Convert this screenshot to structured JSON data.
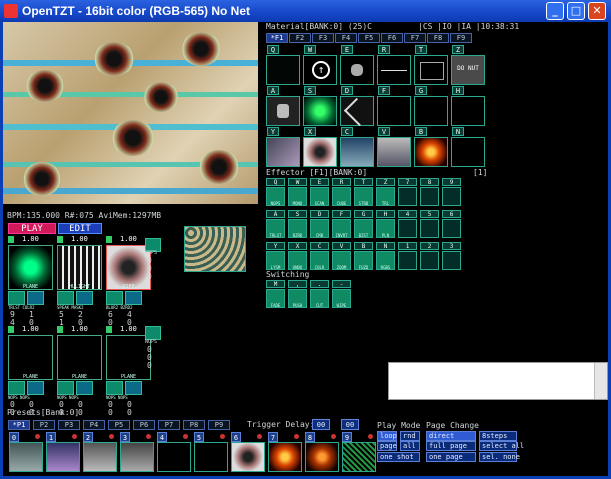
{
  "window": {
    "title": "OpenTZT - 16bit color (RGB-565) No Net",
    "min": "_",
    "max": "□",
    "close": "✕"
  },
  "material": {
    "header": "Material[BANK:0]  (25)C",
    "stats": "|CS |IO  |IA  |10:38:31",
    "tabs": [
      "*F1",
      "F2",
      "F3",
      "F4",
      "F5",
      "F6",
      "F7",
      "F8",
      "F9"
    ],
    "rows": [
      [
        "Q",
        "W",
        "E",
        "R",
        "T",
        "Z"
      ],
      [
        "A",
        "S",
        "D",
        "F",
        "G",
        "H"
      ],
      [
        "Y",
        "X",
        "C",
        "V",
        "B",
        "N"
      ]
    ],
    "donut_text": "DO NUT"
  },
  "effector": {
    "header": "Effector [F1][BANK:0]",
    "header_right": "[1]",
    "rows": [
      [
        "Q",
        "W",
        "E",
        "R",
        "T",
        "Z",
        "7",
        "8",
        "9"
      ],
      [
        "A",
        "S",
        "D",
        "F",
        "G",
        "H",
        "4",
        "5",
        "6"
      ],
      [
        "Y",
        "X",
        "C",
        "V",
        "B",
        "N",
        "1",
        "2",
        "3"
      ]
    ],
    "names": [
      [
        "NOPS",
        "MONO",
        "SCAN",
        "CUBE",
        "STRB",
        "TRL"
      ],
      [
        "TRLST",
        "BZRD",
        "CMB",
        "INVRT",
        "BZST",
        "PLN"
      ],
      [
        "LYSM",
        "UNDO",
        "COLR",
        "ZOOM",
        "FUZD",
        "RGBS"
      ]
    ]
  },
  "switching": {
    "label": "Switching",
    "keys": [
      "M",
      ",",
      ".",
      "-"
    ],
    "names": [
      "FADE",
      "PUSH",
      "CUT",
      "WIPE"
    ]
  },
  "status": {
    "bpm_line": "BPM:135.000 R#:075 AviMem:1297MB"
  },
  "mode": {
    "play": "PLAY",
    "edit": "EDIT"
  },
  "decks_top": [
    {
      "num": "1",
      "val": "1.00",
      "label": "PLANE",
      "fx": "TRLST COLR2",
      "v1": "9",
      "v2": "1",
      "v3": "4",
      "v4": "0"
    },
    {
      "num": "2",
      "val": "1.00",
      "label": "HULIGHT",
      "fx": "SPEAK MASK2",
      "v1": "5",
      "v2": "2",
      "v3": "1",
      "v4": "0"
    },
    {
      "num": "3",
      "val": "1.00",
      "label": "DIFF",
      "fx": "BLUR2 BZRD2",
      "v1": "6",
      "v2": "4",
      "v3": "0",
      "v4": "0"
    }
  ],
  "deck_side": {
    "label": "NOPS",
    "v1": "0",
    "v2": "0",
    "v3": "0"
  },
  "decks_bottom": [
    {
      "num": "4",
      "val": "1.00",
      "label": "PLANE",
      "fx": "NOPS NOPS",
      "v1": "0",
      "v2": "0",
      "v3": "0",
      "v4": "0"
    },
    {
      "num": "5",
      "val": "1.00",
      "label": "PLANE",
      "fx": "NOPS NOPS",
      "v1": "0",
      "v2": "0",
      "v3": "0",
      "v4": "0"
    },
    {
      "num": "6",
      "val": "1.00",
      "label": "PLANE",
      "fx": "NOPS NOPS",
      "v1": "0",
      "v2": "0",
      "v3": "0",
      "v4": "0"
    }
  ],
  "deck_side_b": {
    "label": "NOPS",
    "v1": "0",
    "v2": "0",
    "v3": "0"
  },
  "presets": {
    "label": "Presets[Bank:0]",
    "tabs": [
      "*P1",
      "P2",
      "P3",
      "P4",
      "P5",
      "P6",
      "P7",
      "P8",
      "P9"
    ],
    "trigger_label": "Trigger Delay:",
    "trigger_a": "00",
    "trigger_b": "00",
    "slots": [
      "0",
      "1",
      "2",
      "3",
      "4",
      "5",
      "6",
      "7",
      "8",
      "9"
    ]
  },
  "play_mode": {
    "label": "Play Mode",
    "items": [
      [
        "loop",
        "rnd"
      ],
      [
        "page",
        "all"
      ],
      [
        "one shot"
      ]
    ]
  },
  "page_change": {
    "label": "Page Change",
    "items": [
      "direct",
      "full page",
      "one page"
    ],
    "extra": [
      "8steps",
      "select all",
      "sel. none"
    ]
  },
  "colors": {
    "accent": "#2aa890",
    "title": "#1547c8",
    "panel": "#000000"
  }
}
